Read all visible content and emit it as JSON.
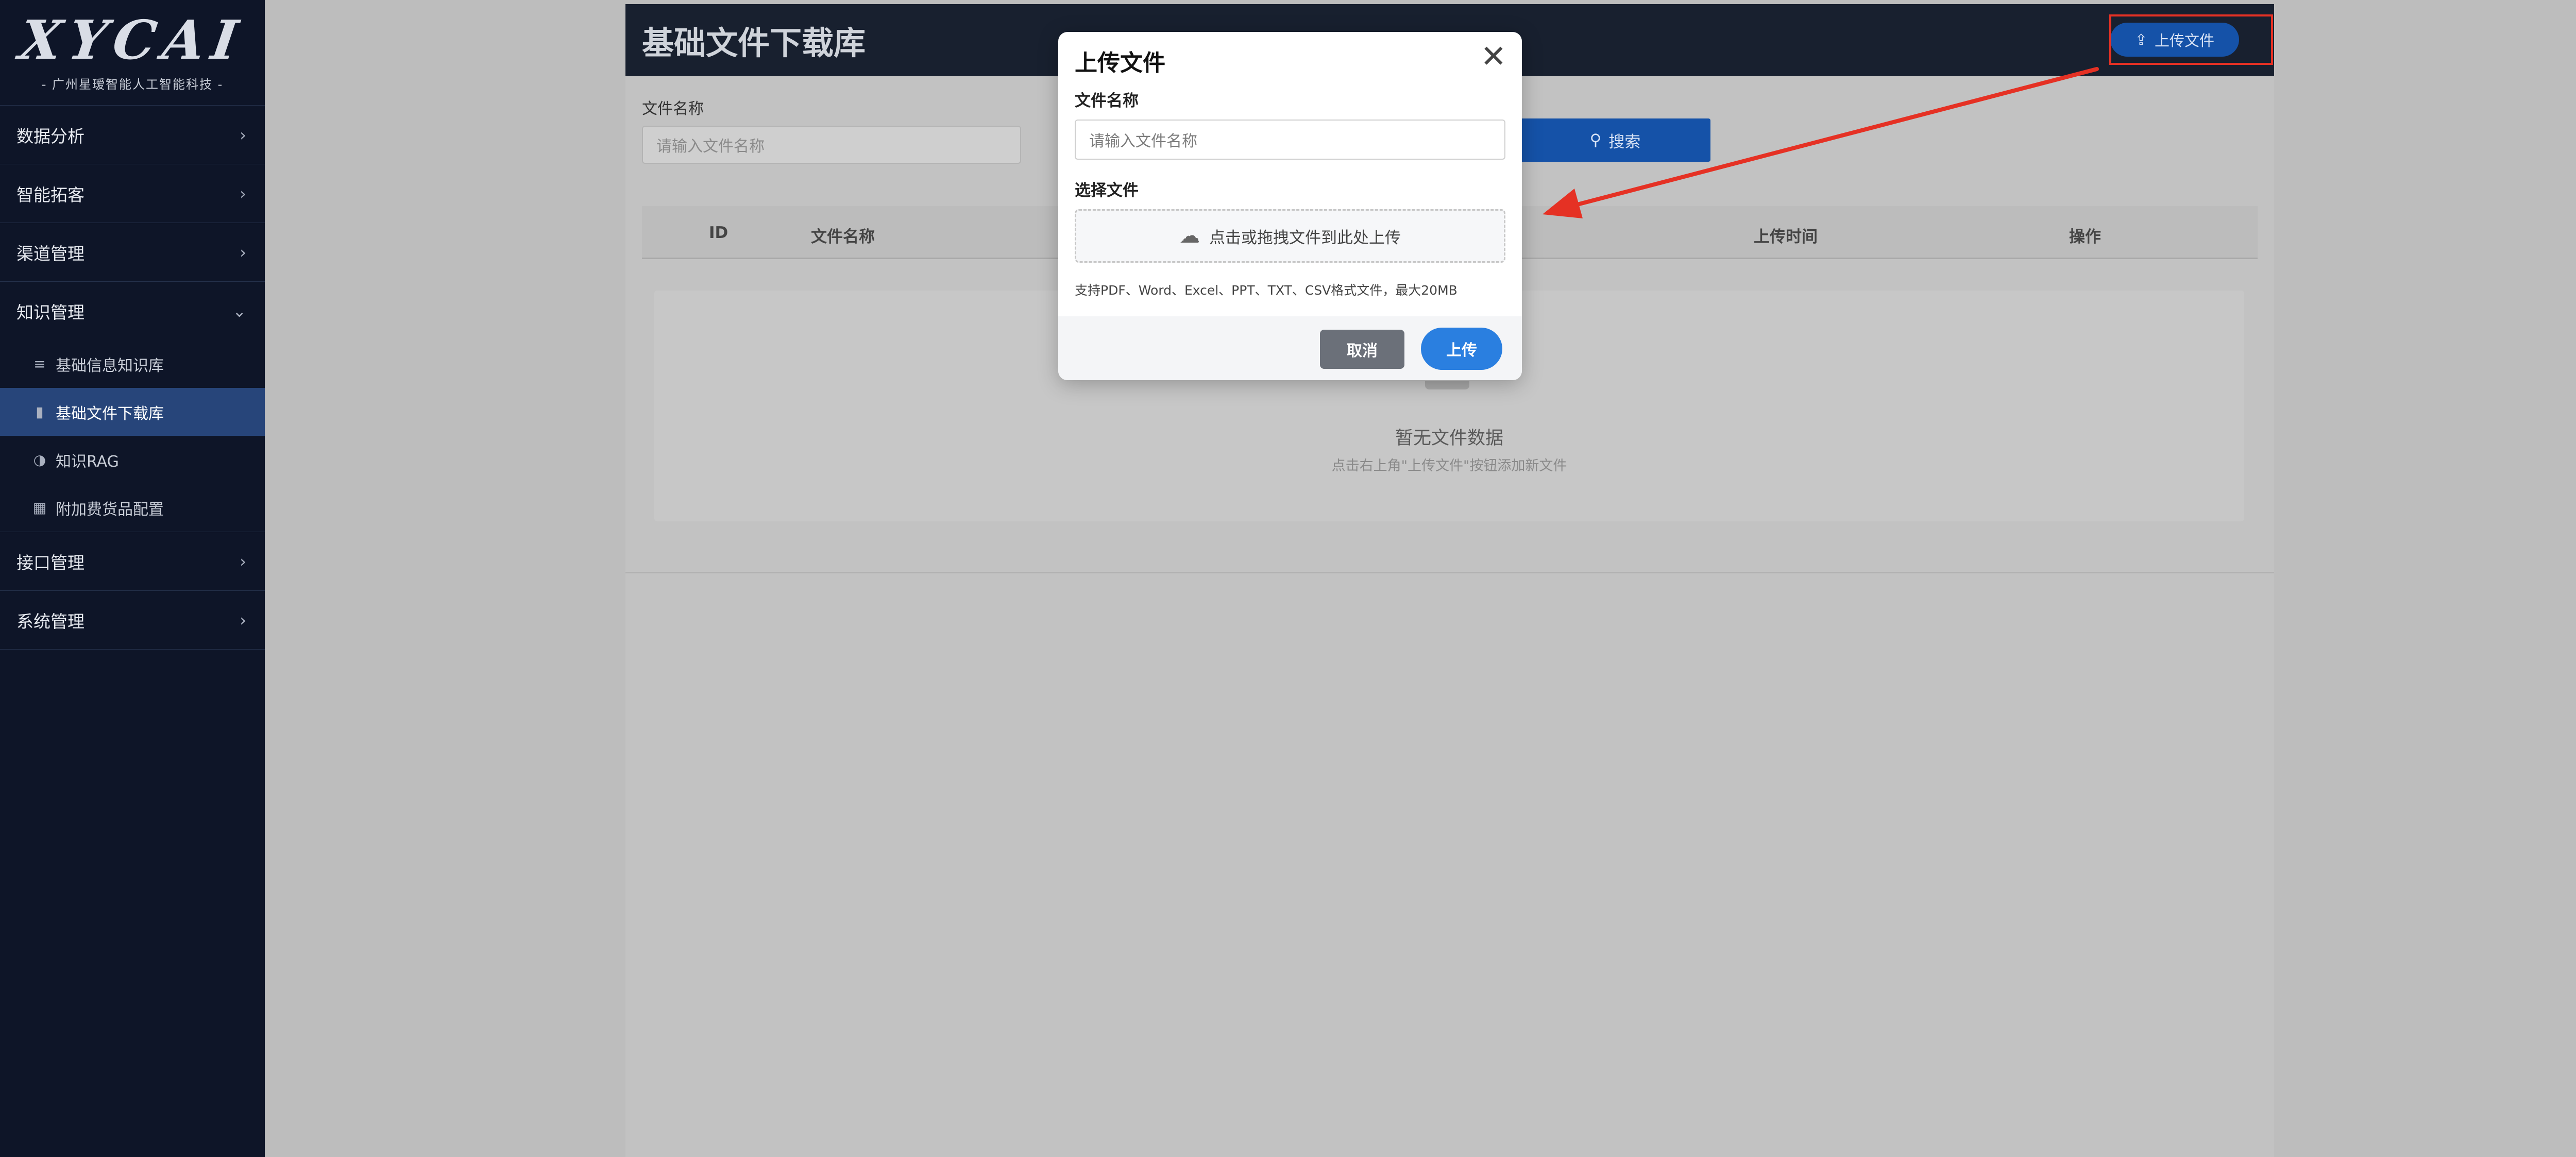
{
  "brand": {
    "logo_text": "XYCAI",
    "tagline": "- 广州星瑷智能人工智能科技 -"
  },
  "sidebar": {
    "menu_before": [
      {
        "label": "数据分析"
      },
      {
        "label": "智能拓客"
      },
      {
        "label": "渠道管理"
      },
      {
        "label": "知识管理"
      }
    ],
    "knowledge_sub": [
      {
        "label": "基础信息知识库",
        "icon": "database-icon"
      },
      {
        "label": "基础文件下载库",
        "icon": "file-icon",
        "active": true
      },
      {
        "label": "知识RAG",
        "icon": "brain-icon"
      },
      {
        "label": "附加费货品配置",
        "icon": "box-icon"
      }
    ],
    "menu_after": [
      {
        "label": "接口管理"
      },
      {
        "label": "系统管理"
      }
    ]
  },
  "page": {
    "title": "基础文件下载库",
    "upload_button": "上传文件",
    "filter": {
      "name_label": "文件名称",
      "name_placeholder": "请输入文件名称",
      "search_label": "搜索"
    },
    "table": {
      "columns": [
        "ID",
        "文件名称",
        "上传时间",
        "操作"
      ]
    },
    "empty": {
      "title": "暂无文件数据",
      "subtitle": "点击右上角\"上传文件\"按钮添加新文件"
    }
  },
  "modal": {
    "title": "上传文件",
    "close_symbol": "✕",
    "name_label": "文件名称",
    "name_placeholder": "请输入文件名称",
    "file_label": "选择文件",
    "dropzone_text": "点击或拖拽文件到此处上传",
    "hint": "支持PDF、Word、Excel、PPT、TXT、CSV格式文件，最大20MB",
    "cancel": "取消",
    "submit": "上传"
  },
  "colors": {
    "sidebar_bg": "#0e1528",
    "accent": "#1552a8",
    "annotation_red": "#e53124",
    "primary_btn": "#2a7fe0"
  }
}
